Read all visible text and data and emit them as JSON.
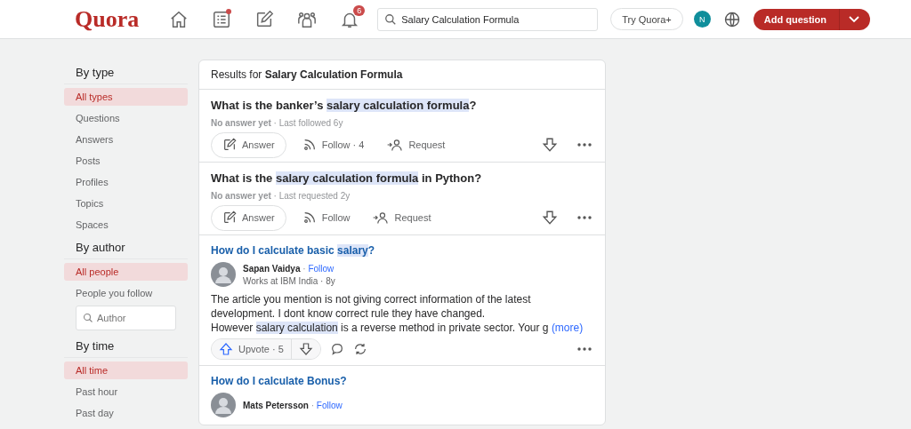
{
  "header": {
    "logo": "Quora",
    "nav": [
      {
        "kind": "home",
        "selected": false
      },
      {
        "kind": "list",
        "selected": false,
        "dot": true
      },
      {
        "kind": "edit",
        "selected": false
      },
      {
        "kind": "people",
        "selected": false
      },
      {
        "kind": "bell",
        "selected": false,
        "badge": "6"
      }
    ],
    "search": {
      "value": "Salary Calculation Formula"
    },
    "try_button": "Try Quora+",
    "avatar": "N",
    "add_button": "Add question"
  },
  "sidebar": [
    {
      "heading": "By type",
      "items": [
        {
          "label": "All types",
          "selected": true
        },
        {
          "label": "Questions",
          "selected": false
        },
        {
          "label": "Answers",
          "selected": false
        },
        {
          "label": "Posts",
          "selected": false
        },
        {
          "label": "Profiles",
          "selected": false
        },
        {
          "label": "Topics",
          "selected": false
        },
        {
          "label": "Spaces",
          "selected": false
        }
      ]
    },
    {
      "heading": "By author",
      "items": [
        {
          "label": "All people",
          "selected": true
        },
        {
          "label": "People you follow",
          "selected": false
        }
      ],
      "field": {
        "placeholder": "Author"
      }
    },
    {
      "heading": "By time",
      "items": [
        {
          "label": "All time",
          "selected": true
        },
        {
          "label": "Past hour",
          "selected": false
        },
        {
          "label": "Past day",
          "selected": false
        }
      ]
    }
  ],
  "results": {
    "heading": "Results for **Salary Calculation Formula**",
    "items": [
      {
        "kind": "question",
        "title": [
          {
            "text": "What is the banker’s ",
            "hl": false
          },
          {
            "text": "salary calculation formula",
            "hl": true
          },
          {
            "text": "?",
            "hl": false
          }
        ],
        "meta": "**No answer yet** · Last followed 6y",
        "answer": "Answer",
        "follow": "Follow · 4",
        "request": "Request"
      },
      {
        "kind": "question",
        "title": [
          {
            "text": "What is the ",
            "hl": false
          },
          {
            "text": "salary calculation formula",
            "hl": true
          },
          {
            "text": " in Python?",
            "hl": false
          }
        ],
        "meta": "**No answer yet** · Last requested 2y",
        "answer": "Answer",
        "follow": "Follow",
        "request": "Request"
      },
      {
        "kind": "answer",
        "title": [
          {
            "text": "How do I calculate basic ",
            "hl": false
          },
          {
            "text": "salary",
            "hl": true
          },
          {
            "text": "?",
            "hl": false
          }
        ],
        "author": "Sapan Vaidya",
        "sep": "·",
        "follow": "Follow",
        "credential": "Works at IBM India · 8y",
        "body": [
          [
            {
              "text": "The article you mention is not giving correct information of the latest development. I dont know correct rule they have changed.",
              "hl": false
            }
          ],
          [
            {
              "text": "However ",
              "hl": false
            },
            {
              "text": "salary calculation",
              "hl": true
            },
            {
              "text": " is a reverse method in private sector. Your g",
              "hl": false
            }
          ]
        ],
        "more": "(more)",
        "upvote": "Upvote · 5"
      },
      {
        "kind": "answer",
        "title": [
          {
            "text": "How do I calculate Bonus?",
            "hl": false
          }
        ],
        "author": "Mats Petersson",
        "sep": "·",
        "follow": "Follow"
      }
    ]
  }
}
